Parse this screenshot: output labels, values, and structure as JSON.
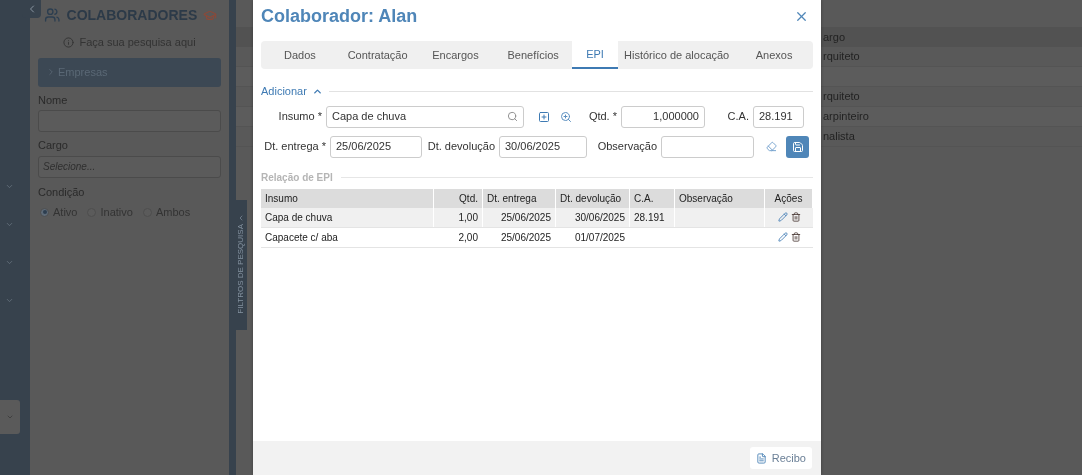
{
  "sidebar": {
    "title": "COLABORADORES",
    "hint": "Faça sua pesquisa aqui",
    "accordion": {
      "label": "Empresas",
      "expanded": false
    },
    "fields": [
      {
        "label": "Nome",
        "kind": "text"
      },
      {
        "label": "Cargo",
        "kind": "select",
        "placeholder": "Selecione..."
      }
    ],
    "condition": {
      "label": "Condição",
      "options": [
        {
          "label": "Ativo",
          "selected": true
        },
        {
          "label": "Inativo",
          "selected": false
        },
        {
          "label": "Ambos",
          "selected": false
        }
      ]
    },
    "filter_tab": "FILTROS DE PESQUISA"
  },
  "background_table": {
    "header": "argo",
    "rows": [
      {
        "cargo": "rquiteto"
      },
      {
        "cargo": null
      },
      {
        "cargo": "rquiteto"
      },
      {
        "cargo": "arpinteiro"
      },
      {
        "cargo": "nalista"
      }
    ]
  },
  "dialog": {
    "title": "Colaborador: Alan",
    "tabs": [
      {
        "label": "Dados",
        "selected": false
      },
      {
        "label": "Contratação",
        "selected": false
      },
      {
        "label": "Encargos",
        "selected": false
      },
      {
        "label": "Benefícios",
        "selected": false
      },
      {
        "label": "EPI",
        "selected": true
      },
      {
        "label": "Histórico de alocação",
        "selected": false
      },
      {
        "label": "Anexos",
        "selected": false
      }
    ],
    "add_section": {
      "label": "Adicionar",
      "expanded": true
    },
    "form": {
      "insumo": {
        "label": "Insumo *",
        "value": "Capa de chuva"
      },
      "qtd": {
        "label": "Qtd. *",
        "value": "1,000000"
      },
      "ca": {
        "label": "C.A.",
        "value": "28.191"
      },
      "entrega": {
        "label": "Dt. entrega *",
        "value": "25/06/2025"
      },
      "devolucao": {
        "label": "Dt. devolução",
        "value": "30/06/2025"
      },
      "observacao": {
        "label": "Observação"
      }
    },
    "list_title": "Relação de EPI",
    "table": {
      "columns": [
        "Insumo",
        "Qtd.",
        "Dt. entrega",
        "Dt. devolução",
        "C.A.",
        "Observação",
        "Ações"
      ],
      "rows": [
        {
          "selected": true,
          "cells": [
            "Capa de chuva",
            "1,00",
            "25/06/2025",
            "30/06/2025",
            "28.191"
          ]
        },
        {
          "selected": false,
          "cells": [
            "Capacete c/ aba",
            "2,00",
            "25/06/2025",
            "01/07/2025"
          ]
        }
      ]
    },
    "footer_button": "Recibo"
  }
}
